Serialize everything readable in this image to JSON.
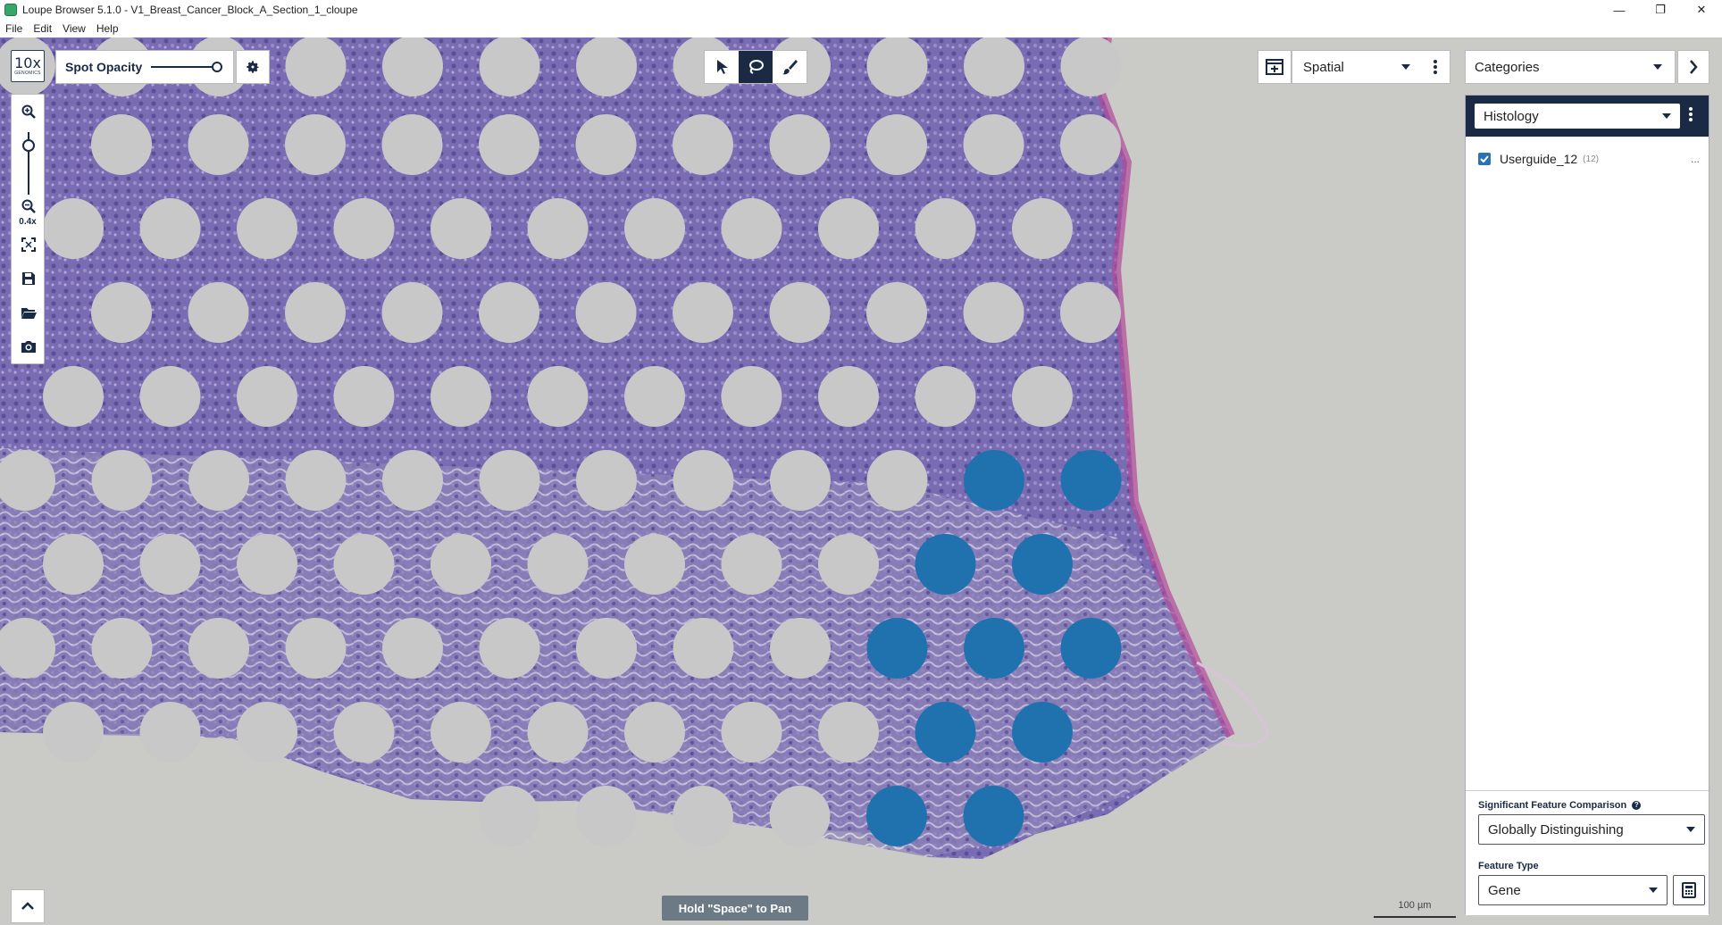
{
  "window": {
    "title": "Loupe Browser 5.1.0 - V1_Breast_Cancer_Block_A_Section_1_cloupe",
    "minimize": "—",
    "restore": "❐",
    "close": "✕"
  },
  "menu": [
    "File",
    "Edit",
    "View",
    "Help"
  ],
  "logo": {
    "line1": "10x",
    "line2": "GENOMICS"
  },
  "spot_opacity": {
    "label": "Spot Opacity",
    "value": 1.0
  },
  "zoom": {
    "level": "0.4x"
  },
  "selection_tools": [
    "pointer-icon",
    "lasso-icon",
    "brush-icon"
  ],
  "view_selector": {
    "value": "Spatial"
  },
  "categories_selector": {
    "value": "Categories"
  },
  "category_panel": {
    "group": "Histology",
    "clusters": [
      {
        "name": "Userguide_12",
        "count": "(12)",
        "checked": true,
        "more": "..."
      }
    ]
  },
  "feature_comparison": {
    "label": "Significant Feature Comparison",
    "help_icon": "?",
    "value": "Globally Distinguishing"
  },
  "feature_type": {
    "label": "Feature Type",
    "value": "Gene"
  },
  "pan_hint": "Hold \"Space\" to Pan",
  "scale_bar": "100 µm",
  "colors": {
    "navy": "#1a2a44",
    "cluster_blue": "#1f72ae",
    "spot_gray": "#c8c8c8",
    "tissue_purple": "#7e6fb4"
  }
}
